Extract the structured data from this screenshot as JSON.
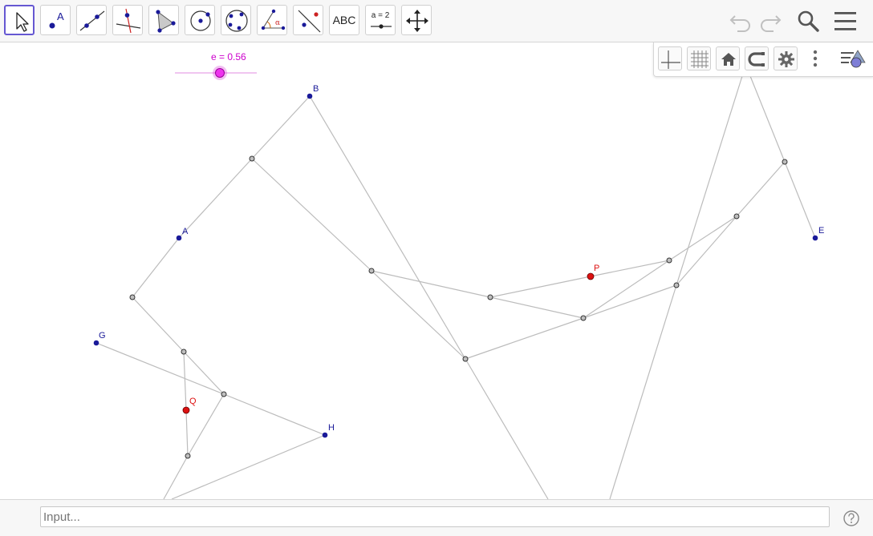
{
  "toolbar": {
    "tools": [
      {
        "name": "move-tool-button",
        "selected": true
      },
      {
        "name": "point-tool-button",
        "label": "A"
      },
      {
        "name": "line-tool-button"
      },
      {
        "name": "perpendicular-line-tool-button"
      },
      {
        "name": "polygon-tool-button"
      },
      {
        "name": "circle-tool-button"
      },
      {
        "name": "conic-tool-button"
      },
      {
        "name": "angle-tool-button",
        "label": "α"
      },
      {
        "name": "reflect-tool-button"
      },
      {
        "name": "text-tool-button",
        "label": "ABC"
      },
      {
        "name": "slider-tool-button",
        "label": "a = 2"
      },
      {
        "name": "move-graphics-view-tool-button"
      }
    ],
    "right_buttons": [
      "undo-icon",
      "redo-icon",
      "search-icon",
      "menu-icon"
    ]
  },
  "graphics_panel": {
    "buttons": [
      "axes-icon",
      "grid-icon",
      "home-icon",
      "point-capture-icon",
      "settings-icon",
      "more-icon",
      "style-bar-toggle-icon"
    ]
  },
  "slider": {
    "label": "e = 0.56",
    "value": 0.56,
    "color": "#cc00cc"
  },
  "points": {
    "B": {
      "label": "B",
      "color": "#1a1a99"
    },
    "A": {
      "label": "A",
      "color": "#1a1a99"
    },
    "G": {
      "label": "G",
      "color": "#1a1a99"
    },
    "H": {
      "label": "H",
      "color": "#1a1a99"
    },
    "E": {
      "label": "E",
      "color": "#1a1a99"
    },
    "P": {
      "label": "P",
      "color": "#dd1111"
    },
    "Q": {
      "label": "Q",
      "color": "#dd1111"
    }
  },
  "colors": {
    "segment": "#bcbcbc",
    "aux_point": "#bfbfbf",
    "selected_tool": "#6557d2"
  },
  "input_bar": {
    "placeholder": "Input..."
  },
  "help_icon": "help-icon"
}
